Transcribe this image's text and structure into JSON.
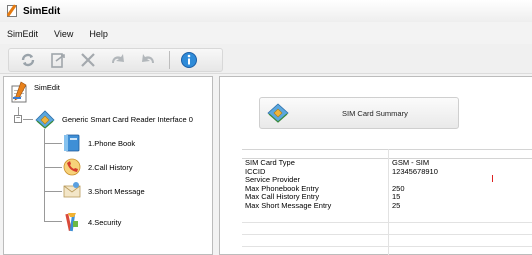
{
  "window": {
    "title": "SimEdit"
  },
  "menu": [
    "SimEdit",
    "View",
    "Help"
  ],
  "toolbar": {
    "buttons": [
      "refresh-icon",
      "export-icon",
      "delete-icon",
      "undo-icon",
      "redo-icon",
      "info-icon"
    ]
  },
  "tree": {
    "root": "SimEdit",
    "reader": "Generic Smart Card Reader Interface 0",
    "expander": "−",
    "items": [
      {
        "label": "1.Phone Book",
        "icon": "phonebook-icon"
      },
      {
        "label": "2.Call History",
        "icon": "call-history-icon"
      },
      {
        "label": "3.Short Message",
        "icon": "sms-icon"
      },
      {
        "label": "4.Security",
        "icon": "security-icon"
      }
    ]
  },
  "summary": {
    "button_label": "SIM Card Summary",
    "rows": [
      {
        "field": "SIM Card Type",
        "value": "GSM - SIM"
      },
      {
        "field": "ICCID",
        "value": "12345678910"
      },
      {
        "field": "Service Provider",
        "value": ""
      },
      {
        "field": "Max Phonebook Entry",
        "value": "250"
      },
      {
        "field": "Max Call History Entry",
        "value": "15"
      },
      {
        "field": "Max Short Message Entry",
        "value": "25"
      }
    ]
  },
  "colors": {
    "accent": "#2f8bd8",
    "background": "#f3f3f3",
    "panel": "#ffffff"
  }
}
